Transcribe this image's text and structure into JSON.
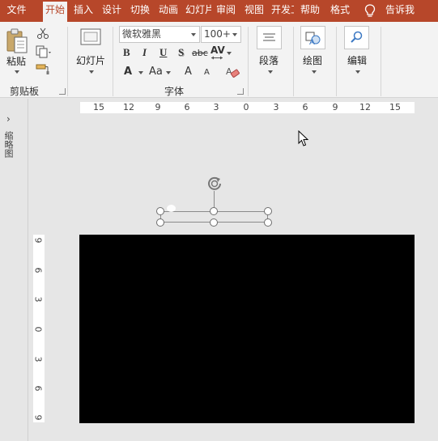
{
  "tabs": [
    {
      "label": "文件",
      "active": false
    },
    {
      "label": "开始",
      "active": true
    },
    {
      "label": "插入",
      "active": false
    },
    {
      "label": "设计",
      "active": false
    },
    {
      "label": "切换",
      "active": false
    },
    {
      "label": "动画",
      "active": false
    },
    {
      "label": "幻灯片放映",
      "active": false
    },
    {
      "label": "审阅",
      "active": false
    },
    {
      "label": "视图",
      "active": false
    },
    {
      "label": "开发工具",
      "active": false
    },
    {
      "label": "帮助",
      "active": false
    },
    {
      "label": "格式",
      "active": false
    }
  ],
  "tell_me": "告诉我",
  "ribbon": {
    "clipboard": {
      "paste": "粘贴",
      "group_label": "剪贴板"
    },
    "slides": {
      "new_slide": "幻灯片"
    },
    "font": {
      "font_name": "微软雅黑",
      "font_size": "100+",
      "group_label": "字体",
      "bold": "B",
      "italic": "I",
      "underline": "U",
      "shadow": "S",
      "strike": "abc",
      "spacing": "AV",
      "font_color": "A",
      "change_case": "Aa",
      "grow": "A",
      "shrink": "A"
    },
    "paragraph": {
      "label": "段落"
    },
    "drawing": {
      "label": "绘图"
    },
    "editing": {
      "label": "编辑"
    }
  },
  "thumbnail_pane": {
    "label": "缩略图"
  },
  "h_ruler": [
    "15",
    "12",
    "9",
    "6",
    "3",
    "0",
    "3",
    "6",
    "9",
    "12",
    "15"
  ],
  "v_ruler": [
    "9",
    "6",
    "3",
    "0",
    "3",
    "6",
    "9"
  ],
  "colors": {
    "accent": "#b7472a",
    "ribbon_bg": "#f3f3f3",
    "workspace": "#e6e6e6",
    "slide": "#000000"
  }
}
